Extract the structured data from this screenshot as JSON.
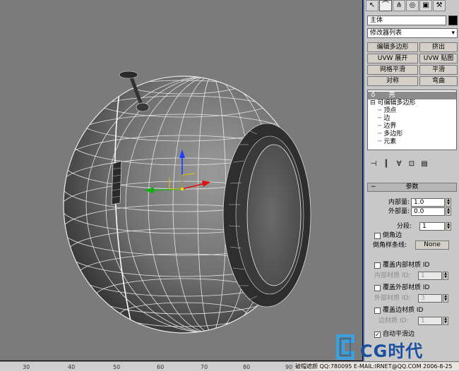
{
  "toolbar": {
    "tabs": [
      "create-icon",
      "modify-icon",
      "hierarchy-icon",
      "motion-icon",
      "display-icon",
      "utilities-icon"
    ]
  },
  "object_name": "主体",
  "modifier_list": "修改器列表",
  "modifier_buttons": [
    [
      "编辑多边形",
      "挤出"
    ],
    [
      "UVW 展开",
      "UVW 贴图"
    ],
    [
      "网格平滑",
      "平滑"
    ],
    [
      "对称",
      "弯曲"
    ]
  ],
  "stack": {
    "modifier": "壳",
    "base": "可编辑多边形",
    "subobjects": [
      "顶点",
      "边",
      "边界",
      "多边形",
      "元素"
    ]
  },
  "rollout": {
    "title": "参数",
    "inner_amount_label": "内部量:",
    "inner_amount_value": "1.0",
    "outer_amount_label": "外部量:",
    "outer_amount_value": "0.0",
    "segments_label": "分段:",
    "segments_value": "1",
    "bevel_edges_label": "倒角边",
    "bevel_spline_label": "倒角样条线:",
    "bevel_spline_value": "None",
    "override_inner_mat_label": "覆盖内部材质 ID",
    "inner_mat_label": "内部材质 ID:",
    "inner_mat_value": "1",
    "override_outer_mat_label": "覆盖外部材质 ID",
    "outer_mat_label": "外部材质 ID:",
    "outer_mat_value": "3",
    "override_edge_mat_label": "覆盖边材质 ID",
    "edge_mat_label": "边材质 ID:",
    "edge_mat_value": "1",
    "auto_smooth_label": "自动平滑边",
    "auto_smooth_checked": true
  },
  "ruler_ticks": [
    "30",
    "40",
    "50",
    "60",
    "70",
    "80",
    "90",
    "100"
  ],
  "watermark": {
    "logo_text": "CG时代",
    "footer": "破帽遮颜 QQ:780095 E-MAIL:IRNET@QQ.COM 2006-8-25"
  }
}
